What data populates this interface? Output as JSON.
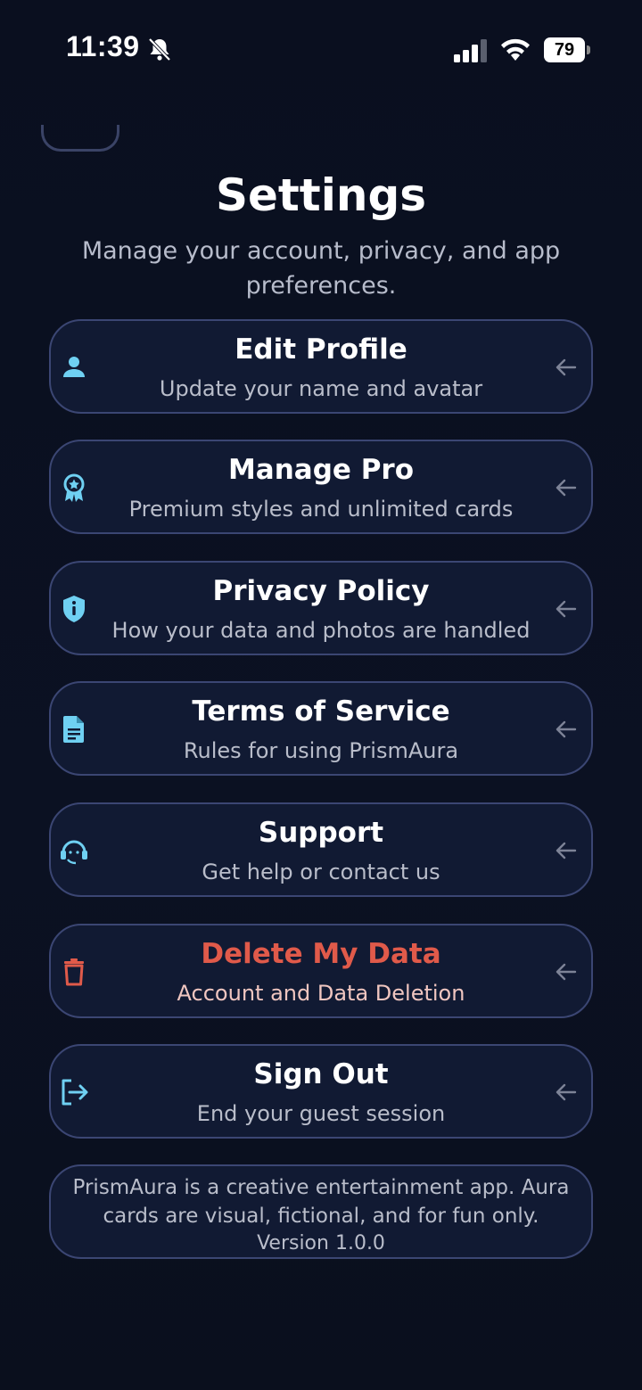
{
  "status_bar": {
    "time": "11:39",
    "battery": "79",
    "icons": [
      "bell-muted-icon",
      "cellular-signal-icon",
      "wifi-icon",
      "battery-icon"
    ]
  },
  "header": {
    "title": "Settings",
    "subtitle": "Manage your account, privacy, and app preferences."
  },
  "colors": {
    "accent": "#6fd0f2",
    "danger": "#e05a4a",
    "card_border": "#3b4673",
    "background": "#0b1020"
  },
  "menu": {
    "items": [
      {
        "label": "Edit Profile",
        "desc": "Update your name and avatar",
        "icon": "user-icon"
      },
      {
        "label": "Manage Pro",
        "desc": "Premium styles and unlimited cards",
        "icon": "badge-star-icon"
      },
      {
        "label": "Privacy Policy",
        "desc": "How your data and photos are handled",
        "icon": "shield-info-icon"
      },
      {
        "label": "Terms of Service",
        "desc": "Rules for using PrismAura",
        "icon": "document-icon"
      },
      {
        "label": "Support",
        "desc": "Get help or contact us",
        "icon": "support-agent-icon"
      },
      {
        "label": "Delete My Data",
        "desc": "Account and Data Deletion",
        "icon": "trash-icon"
      },
      {
        "label": "Sign Out",
        "desc": "End your guest session",
        "icon": "logout-icon"
      }
    ]
  },
  "footer": {
    "text": "PrismAura is a creative entertainment app. Aura cards are visual, fictional, and for fun only.",
    "version": "Version 1.0.0"
  }
}
